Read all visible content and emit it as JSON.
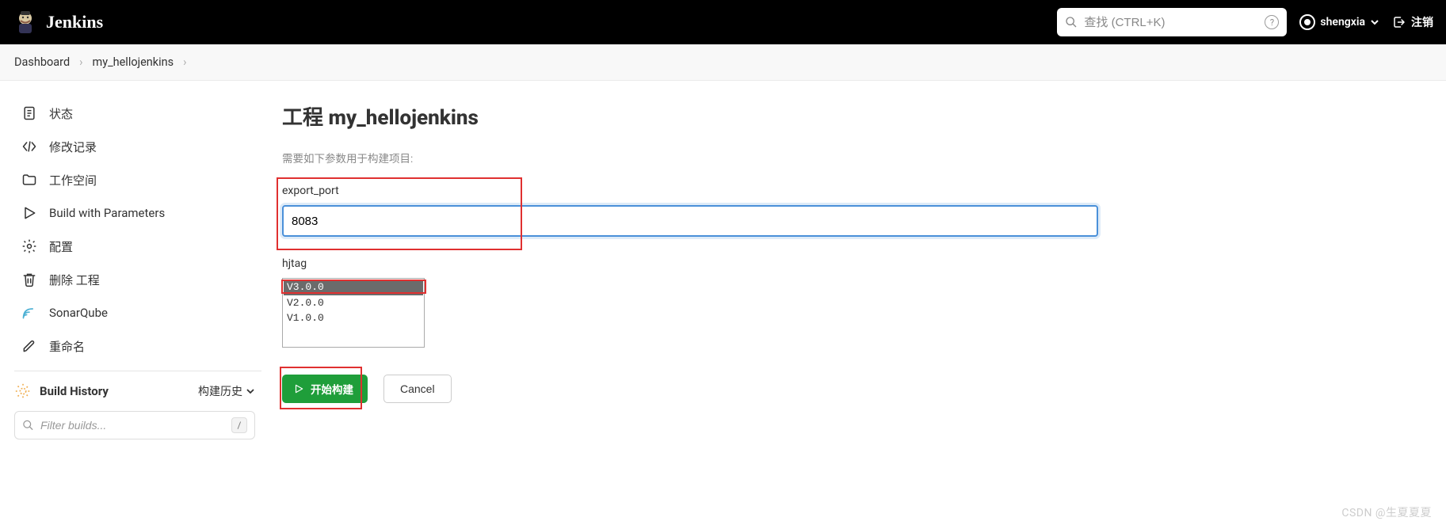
{
  "header": {
    "brand": "Jenkins",
    "search_placeholder": "查找 (CTRL+K)",
    "username": "shengxia",
    "logout": "注销"
  },
  "breadcrumb": {
    "items": [
      "Dashboard",
      "my_hellojenkins"
    ]
  },
  "sidebar": {
    "items": [
      {
        "label": "状态",
        "icon": "file-icon"
      },
      {
        "label": "修改记录",
        "icon": "code-icon"
      },
      {
        "label": "工作空间",
        "icon": "folder-icon"
      },
      {
        "label": "Build with Parameters",
        "icon": "play-icon"
      },
      {
        "label": "配置",
        "icon": "gear-icon"
      },
      {
        "label": "删除 工程",
        "icon": "trash-icon"
      },
      {
        "label": "SonarQube",
        "icon": "sonar-icon"
      },
      {
        "label": "重命名",
        "icon": "pencil-icon"
      }
    ],
    "history_title": "Build History",
    "history_label": "构建历史",
    "filter_placeholder": "Filter builds..."
  },
  "main": {
    "title": "工程 my_hellojenkins",
    "desc": "需要如下参数用于构建项目:",
    "params": {
      "export_port": {
        "label": "export_port",
        "value": "8083"
      },
      "hjtag": {
        "label": "hjtag",
        "options": [
          "V3.0.0",
          "V2.0.0",
          "V1.0.0"
        ],
        "selected": "V3.0.0"
      }
    },
    "build_btn": "开始构建",
    "cancel_btn": "Cancel"
  },
  "watermark": "CSDN @生夏夏夏"
}
